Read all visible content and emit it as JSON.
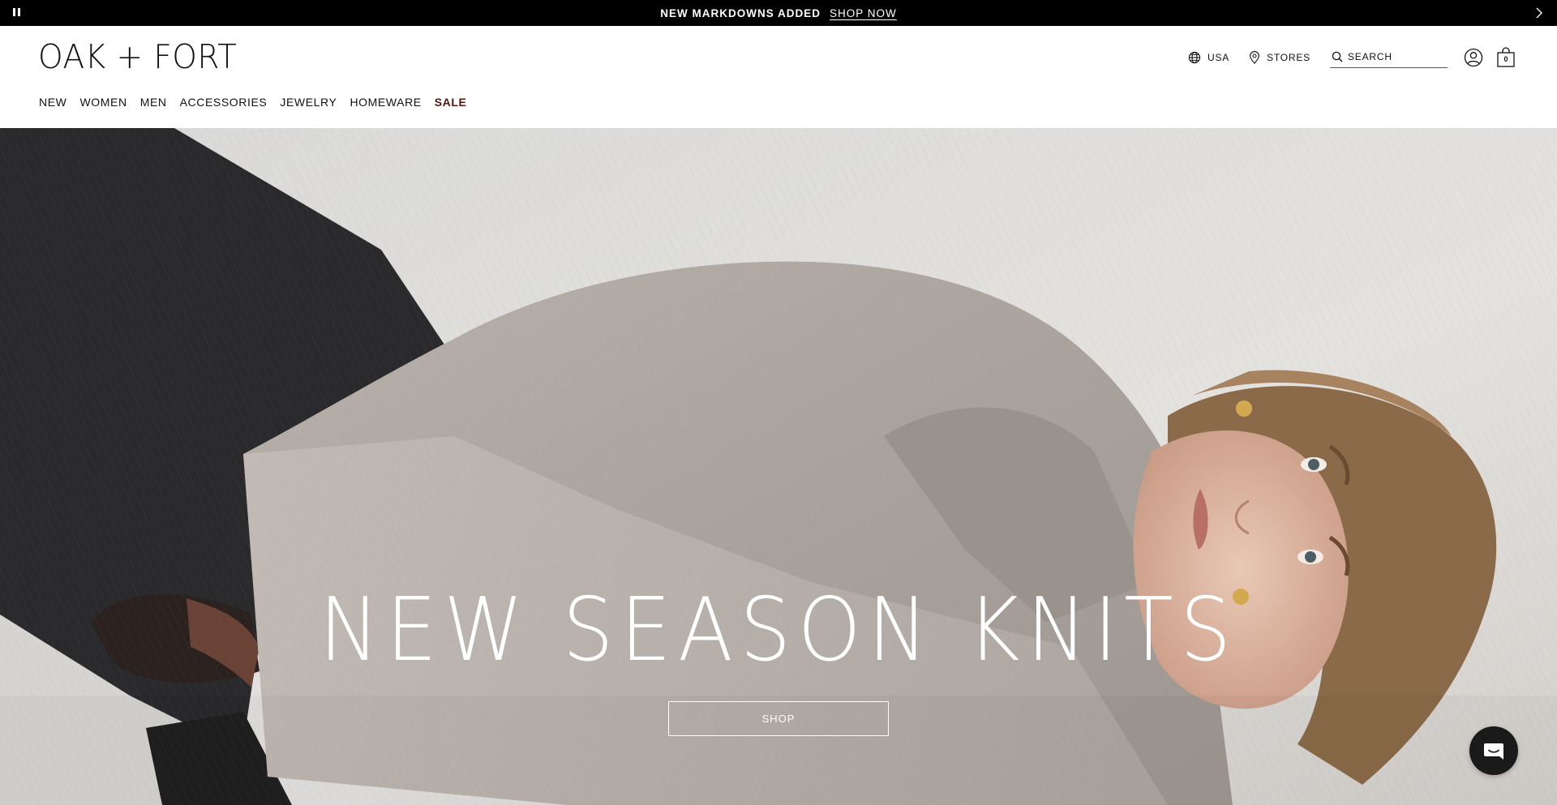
{
  "announcement": {
    "message": "NEW MARKDOWNS ADDED",
    "cta_label": "SHOP NOW"
  },
  "header": {
    "logo_text": "OAK + FORT",
    "nav": [
      {
        "label": "NEW"
      },
      {
        "label": "WOMEN"
      },
      {
        "label": "MEN"
      },
      {
        "label": "ACCESSORIES"
      },
      {
        "label": "JEWELRY"
      },
      {
        "label": "HOMEWARE"
      },
      {
        "label": "SALE",
        "highlight": true
      }
    ],
    "utilities": {
      "region_label": "USA",
      "stores_label": "STORES",
      "search_placeholder": "SEARCH",
      "cart_count": "0"
    }
  },
  "hero": {
    "title": "NEW SEASON KNITS",
    "cta_label": "SHOP"
  },
  "icons": {
    "pause": "pause-icon",
    "next": "chevron-right-icon",
    "globe": "globe-icon",
    "location": "map-pin-icon",
    "search": "search-icon",
    "account": "account-icon",
    "cart": "shopping-bag-icon",
    "chat": "chat-icon"
  },
  "colors": {
    "announcement_bg": "#000000",
    "sale_accent": "#5a1414",
    "chat_bg": "#1a1a1a"
  }
}
